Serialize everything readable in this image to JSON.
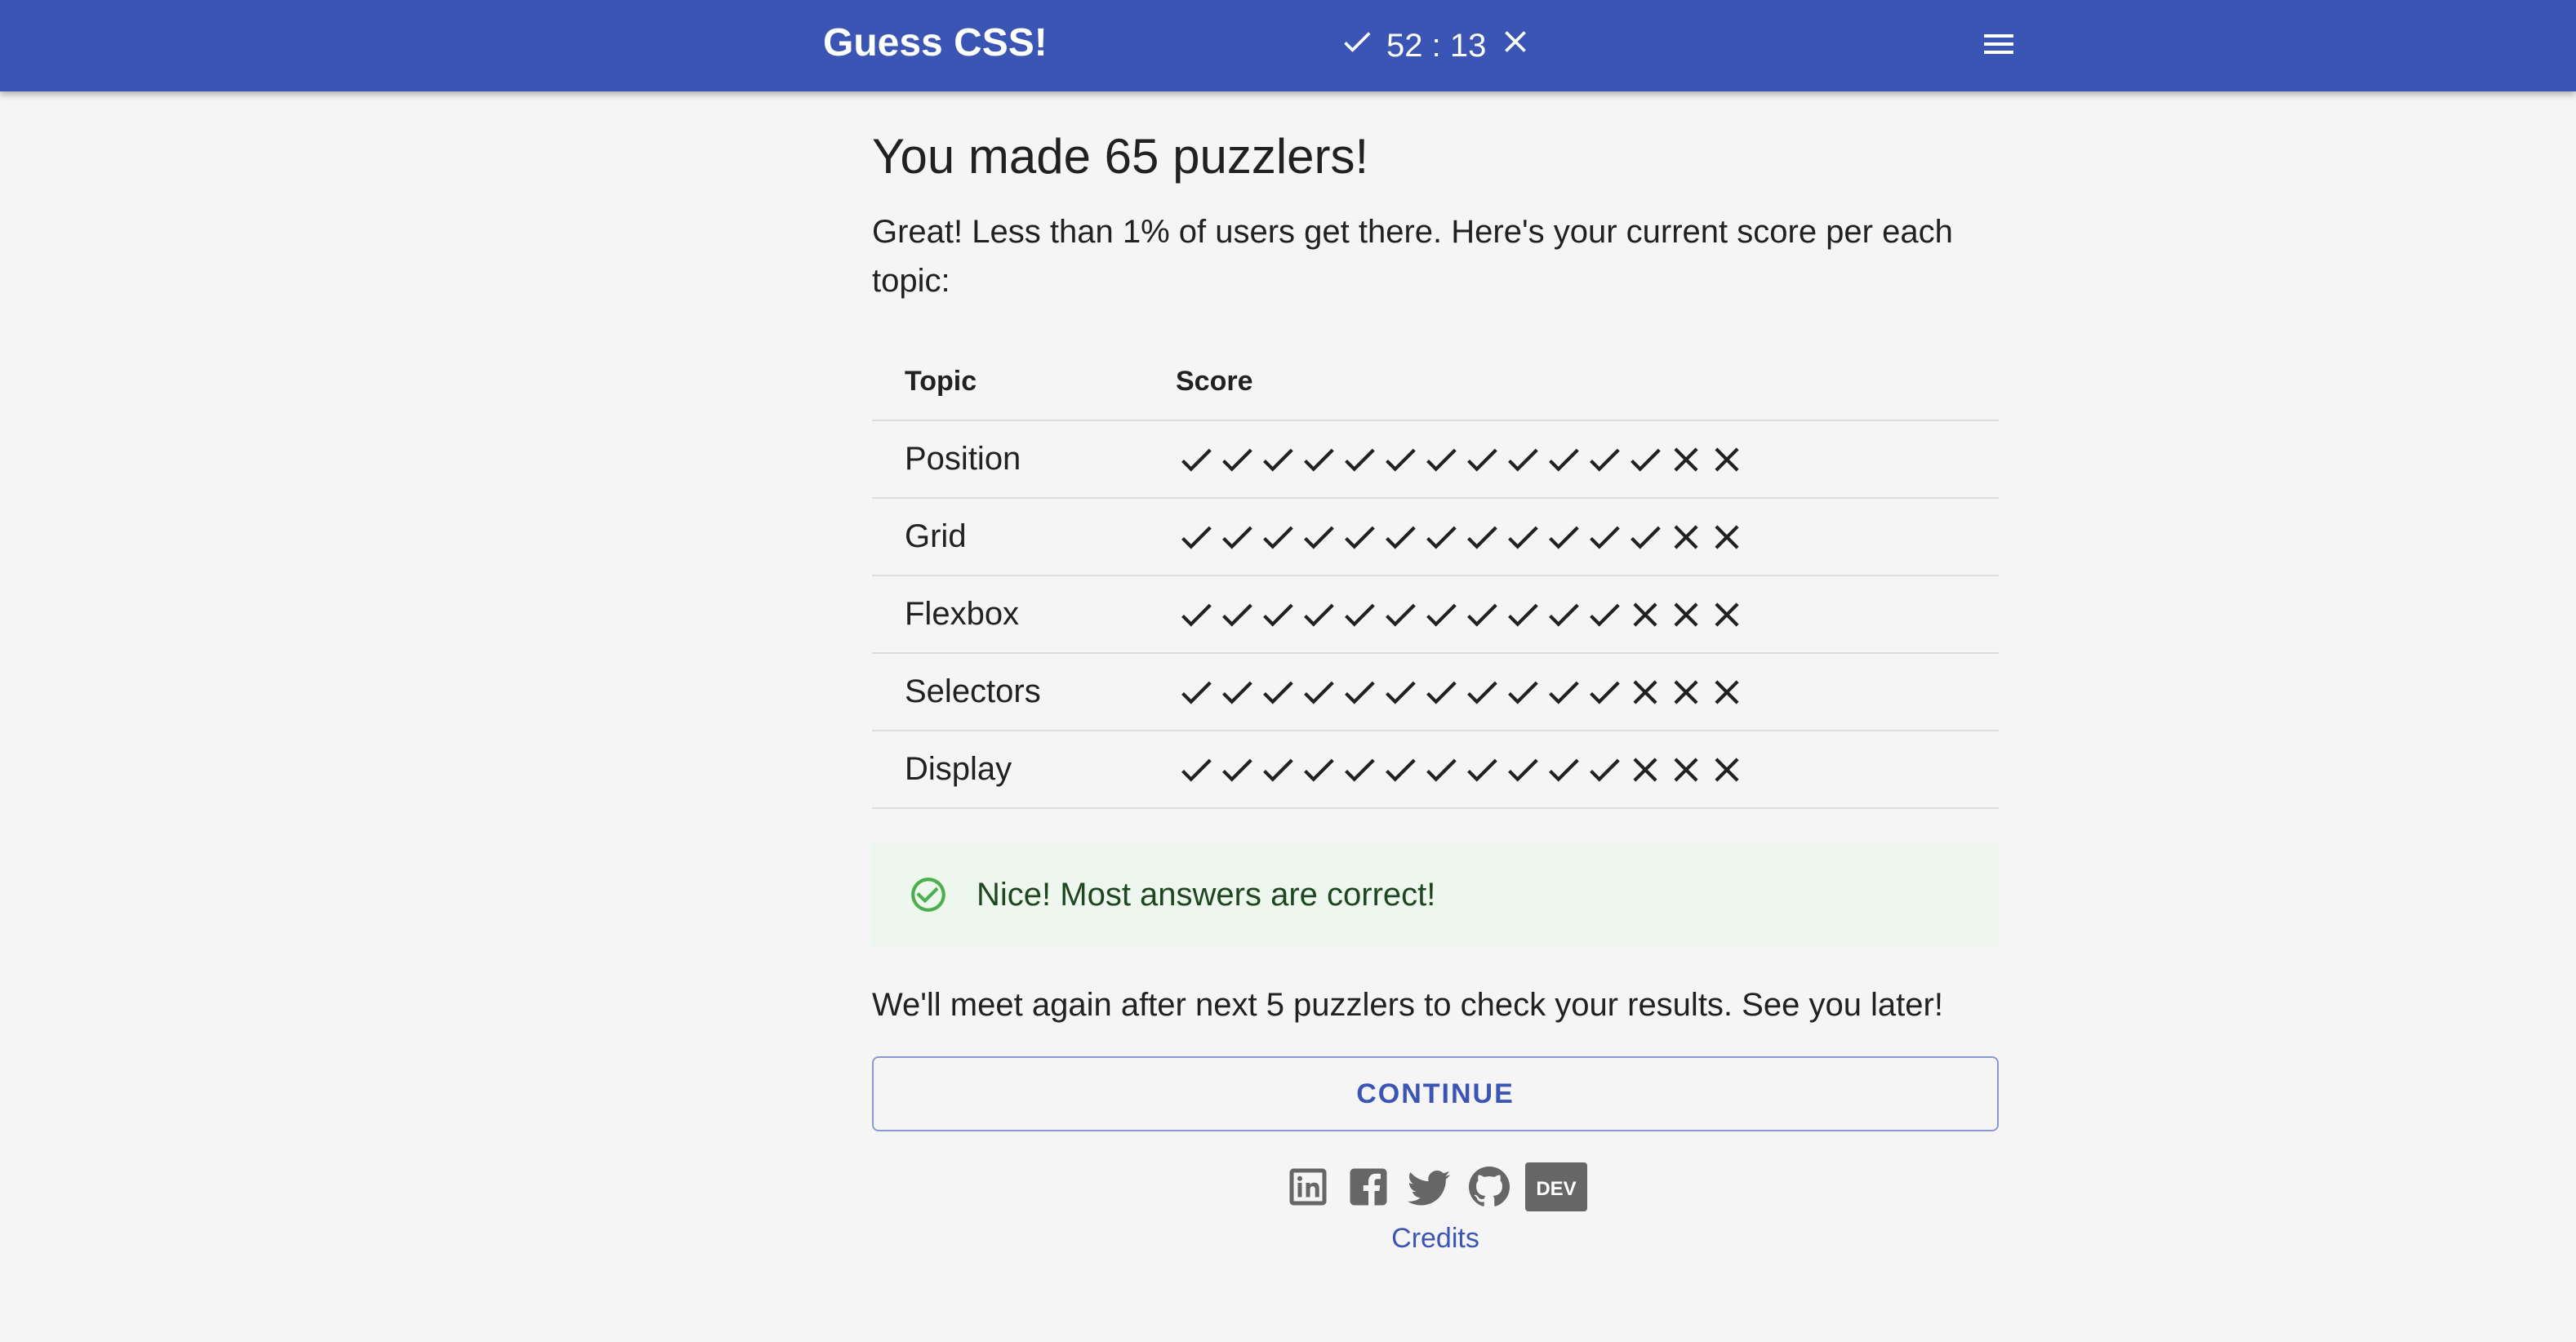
{
  "app": {
    "title": "Guess CSS!",
    "counter": "52 : 13",
    "accent_color": "#3a55b4",
    "icons": {
      "correct": "check-icon",
      "wrong": "cross-icon",
      "menu": "hamburger-menu-icon"
    }
  },
  "results": {
    "headline": "You made 65 puzzlers!",
    "intro": "Great! Less than 1% of users get there. Here's your current score per each topic:",
    "table": {
      "headers": [
        "Topic",
        "Score"
      ],
      "rows": [
        {
          "topic": "Position",
          "correct": 12,
          "wrong": 2
        },
        {
          "topic": "Grid",
          "correct": 12,
          "wrong": 2
        },
        {
          "topic": "Flexbox",
          "correct": 11,
          "wrong": 3
        },
        {
          "topic": "Selectors",
          "correct": 11,
          "wrong": 3
        },
        {
          "topic": "Display",
          "correct": 11,
          "wrong": 3
        }
      ]
    },
    "alert": {
      "text": "Nice! Most answers are correct!",
      "icon": "check-circle-icon",
      "color": "#4caf50"
    },
    "outro": "We'll meet again after next 5 puzzlers to check your results. See you later!",
    "continue_label": "CONTINUE"
  },
  "footer": {
    "social": [
      {
        "name": "linkedin-icon"
      },
      {
        "name": "facebook-icon"
      },
      {
        "name": "twitter-icon"
      },
      {
        "name": "github-icon"
      },
      {
        "name": "dev-icon",
        "label": "DEV"
      }
    ],
    "credits_label": "Credits"
  }
}
